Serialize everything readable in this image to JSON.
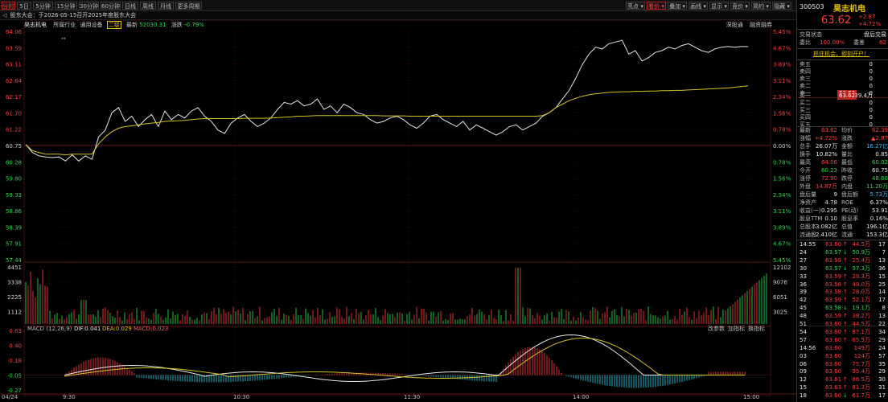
{
  "toolbar": {
    "tabs_left": [
      {
        "label": "分时",
        "active": true
      },
      {
        "label": "5日",
        "active": false
      },
      {
        "label": "5分钟",
        "active": false
      },
      {
        "label": "15分钟",
        "active": false
      },
      {
        "label": "30分钟",
        "active": false
      },
      {
        "label": "60分钟",
        "active": false
      },
      {
        "label": "日线",
        "active": false
      },
      {
        "label": "周线",
        "active": false
      },
      {
        "label": "月线",
        "active": false
      },
      {
        "label": "更多周期",
        "active": false
      }
    ],
    "tabs_right": [
      {
        "label": "亮点",
        "active": false
      },
      {
        "label": "看价",
        "active": true
      },
      {
        "label": "叠加",
        "active": false
      },
      {
        "label": "画线",
        "active": false
      },
      {
        "label": "显示",
        "active": false
      },
      {
        "label": "竞价",
        "active": false
      },
      {
        "label": "简约",
        "active": false
      },
      {
        "label": "隐藏",
        "active": false
      }
    ]
  },
  "notice": "股东大会：于2026-05-15召开2025年度股东大会",
  "infobar": {
    "name": "昊志机电",
    "industry_label": "所属行业",
    "industry": "通用设备",
    "level": "二级",
    "index_label": "最新",
    "index_value": "52030.31",
    "change_label": "涨跌",
    "change_value": "-0.79%",
    "right1": "深股通",
    "right2": "融资融券"
  },
  "price_axis": {
    "left": [
      "64.06",
      "63.59",
      "63.11",
      "62.64",
      "62.17",
      "61.70",
      "61.22",
      "60.75",
      "60.28",
      "59.80",
      "59.33",
      "58.86",
      "58.39",
      "57.91",
      "57.44"
    ],
    "right": [
      "5.45%",
      "4.67%",
      "3.89%",
      "3.11%",
      "2.34%",
      "1.56%",
      "0.78%",
      "0.00%",
      "0.78%",
      "1.56%",
      "2.34%",
      "3.11%",
      "3.89%",
      "4.67%",
      "5.45%"
    ]
  },
  "volume_axis": {
    "left": [
      "4451",
      "3338",
      "2225",
      "1112"
    ],
    "right": [
      "12102",
      "9076",
      "6051",
      "3025"
    ]
  },
  "macd": {
    "title": "MACD (12,26,9)",
    "dif": "DIF:0.041",
    "dea": "DEA:0.029",
    "macd": "MACD:0.023",
    "right_labels": [
      "改参数",
      "加指标",
      "换指标"
    ],
    "axis": [
      "0.63",
      "0.40",
      "0.18",
      "-0.05",
      "-0.27"
    ]
  },
  "time_axis": [
    "04/24",
    "9:30",
    "10:30",
    "11:30",
    "14:00",
    "15:00"
  ],
  "chart_data": {
    "type": "line",
    "series": [
      {
        "name": "price",
        "values": [
          60.78,
          60.55,
          60.45,
          60.42,
          60.4,
          60.42,
          60.3,
          60.48,
          60.3,
          60.45,
          60.35,
          61.0,
          61.2,
          61.7,
          61.85,
          61.45,
          61.6,
          61.3,
          61.5,
          61.65,
          61.3,
          61.75,
          61.5,
          61.65,
          61.55,
          61.75,
          61.85,
          61.6,
          61.45,
          61.2,
          61.1,
          61.4,
          61.55,
          61.65,
          61.45,
          61.3,
          61.4,
          61.55,
          61.8,
          62.0,
          61.95,
          62.05,
          61.9,
          61.95,
          62.1,
          61.8,
          61.9,
          61.7,
          61.95,
          61.85,
          61.7,
          61.65,
          61.5,
          61.4,
          61.45,
          61.55,
          61.6,
          61.5,
          61.35,
          61.25,
          61.4,
          61.6,
          61.65,
          61.5,
          61.4,
          61.3,
          61.45,
          61.2,
          61.35,
          61.25,
          61.15,
          61.05,
          61.15,
          61.3,
          61.35,
          61.2,
          61.3,
          61.4,
          61.6,
          61.7,
          61.85,
          62.1,
          62.35,
          62.7,
          63.1,
          63.4,
          63.6,
          63.55,
          63.7,
          63.75,
          63.8,
          63.4,
          63.5,
          63.2,
          63.3,
          63.45,
          63.5,
          63.6,
          63.55,
          63.65,
          63.7,
          63.6,
          63.5,
          63.45,
          63.55,
          63.6,
          63.62,
          63.6,
          63.62,
          63.62
        ]
      },
      {
        "name": "avg",
        "values": [
          60.78,
          60.6,
          60.55,
          60.5,
          60.5,
          60.5,
          60.48,
          60.5,
          60.5,
          60.5,
          60.5,
          60.8,
          61.0,
          61.15,
          61.25,
          61.3,
          61.32,
          61.35,
          61.38,
          61.4,
          61.42,
          61.45,
          61.46,
          61.47,
          61.48,
          61.5,
          61.52,
          61.53,
          61.53,
          61.53,
          61.53,
          61.53,
          61.53,
          61.54,
          61.54,
          61.54,
          61.54,
          61.55,
          61.56,
          61.57,
          61.58,
          61.6,
          61.6,
          61.61,
          61.62,
          61.62,
          61.62,
          61.62,
          61.62,
          61.62,
          61.62,
          61.62,
          61.62,
          61.62,
          61.61,
          61.61,
          61.61,
          61.61,
          61.6,
          61.6,
          61.6,
          61.6,
          61.6,
          61.6,
          61.6,
          61.6,
          61.6,
          61.6,
          61.6,
          61.6,
          61.6,
          61.6,
          61.6,
          61.6,
          61.6,
          61.6,
          61.6,
          61.6,
          61.62,
          61.7,
          61.85,
          61.95,
          62.05,
          62.12,
          62.18,
          62.22,
          62.25,
          62.27,
          62.29,
          62.3,
          62.31,
          62.31,
          62.32,
          62.32,
          62.33,
          62.33,
          62.34,
          62.34,
          62.35,
          62.35,
          62.36,
          62.37,
          62.38,
          62.39,
          62.4,
          62.41,
          62.42,
          62.44,
          62.46,
          62.48
        ]
      }
    ],
    "ylim": [
      57.44,
      64.06
    ]
  },
  "quote": {
    "code": "300503",
    "name": "昊志机电",
    "price": "63.62",
    "change": "+2.87",
    "pct": "+4.72%",
    "status_label": "交易状态",
    "status_value": "盘后交易",
    "ratio_label": "委比",
    "ratio_value": "100.00%",
    "diff_label": "委差",
    "diff_value": "62",
    "ad_text": "抓住机会，即刻开户！",
    "sells": [
      {
        "label": "卖五",
        "price": "",
        "vol": "0"
      },
      {
        "label": "卖四",
        "price": "",
        "vol": "0"
      },
      {
        "label": "卖三",
        "price": "",
        "vol": "0"
      },
      {
        "label": "卖二",
        "price": "",
        "vol": "0"
      },
      {
        "label": "卖一",
        "price": "63.62",
        "vol": "0"
      }
    ],
    "buys": [
      {
        "label": "买一",
        "price": "63.62",
        "vol": "39.4万"
      },
      {
        "label": "买二",
        "price": "",
        "vol": "0"
      },
      {
        "label": "买三",
        "price": "",
        "vol": "0"
      },
      {
        "label": "买四",
        "price": "",
        "vol": "0"
      },
      {
        "label": "买五",
        "price": "",
        "vol": "0"
      }
    ],
    "stats": [
      {
        "l1": "最新",
        "v1": "63.62",
        "c1": "red",
        "l2": "均价",
        "v2": "62.39",
        "c2": "red"
      },
      {
        "l1": "涨幅",
        "v1": "+4.72%",
        "c1": "red",
        "l2": "涨跌",
        "v2": "▲2.87",
        "c2": "red"
      },
      {
        "l1": "总手",
        "v1": "26.07万",
        "c1": "wht",
        "l2": "金额",
        "v2": "16.27亿",
        "c2": "cyan"
      },
      {
        "l1": "换手",
        "v1": "10.82%",
        "c1": "wht",
        "l2": "量比",
        "v2": "0.85",
        "c2": "wht"
      },
      {
        "l1": "最高",
        "v1": "64.06",
        "c1": "red",
        "l2": "最低",
        "v2": "60.02",
        "c2": "grn"
      },
      {
        "l1": "今开",
        "v1": "60.23",
        "c1": "grn",
        "l2": "昨收",
        "v2": "60.75",
        "c2": "wht"
      },
      {
        "l1": "涨停",
        "v1": "72.90",
        "c1": "red",
        "l2": "跌停",
        "v2": "48.60",
        "c2": "grn"
      },
      {
        "l1": "外盘",
        "v1": "14.87万",
        "c1": "red",
        "l2": "内盘",
        "v2": "11.20万",
        "c2": "grn"
      },
      {
        "l1": "盘后量",
        "v1": "9",
        "c1": "wht",
        "l2": "盘后额",
        "v2": "5.73万",
        "c2": "cyan"
      },
      {
        "l1": "净资产",
        "v1": "4.78",
        "c1": "wht",
        "l2": "ROE",
        "v2": "6.37%",
        "c2": "wht"
      },
      {
        "l1": "收益(一)",
        "v1": "0.295",
        "c1": "wht",
        "l2": "PE(动)",
        "v2": "53.91",
        "c2": "wht"
      },
      {
        "l1": "股息TTM",
        "v1": "0.10",
        "c1": "wht",
        "l2": "股息率",
        "v2": "0.16%",
        "c2": "wht"
      },
      {
        "l1": "总股本",
        "v1": "3.082亿",
        "c1": "wht",
        "l2": "总值",
        "v2": "196.1亿",
        "c2": "wht"
      },
      {
        "l1": "流通股",
        "v1": "2.410亿",
        "c1": "wht",
        "l2": "流通",
        "v2": "153.3亿",
        "c2": "wht"
      }
    ],
    "ticks": [
      {
        "t": "14:55",
        "p": "63.60",
        "d": "↑",
        "v": "44.5万",
        "n": "17",
        "c": "red"
      },
      {
        "t": "24",
        "p": "63.57",
        "d": "↓",
        "v": "50.9万",
        "n": "7",
        "c": "grn"
      },
      {
        "t": "27",
        "p": "63.59",
        "d": "↑",
        "v": "25.4万",
        "n": "13",
        "c": "red"
      },
      {
        "t": "30",
        "p": "63.57",
        "d": "↓",
        "v": "97.3万",
        "n": "36",
        "c": "grn"
      },
      {
        "t": "33",
        "p": "63.59",
        "d": "↑",
        "v": "29.3万",
        "n": "15",
        "c": "red"
      },
      {
        "t": "36",
        "p": "63.58",
        "d": "↑",
        "v": "49.0万",
        "n": "25",
        "c": "red"
      },
      {
        "t": "39",
        "p": "63.58",
        "d": "↑",
        "v": "28.0万",
        "n": "14",
        "c": "red"
      },
      {
        "t": "42",
        "p": "63.59",
        "d": "↑",
        "v": "52.1万",
        "n": "17",
        "c": "red"
      },
      {
        "t": "45",
        "p": "63.58",
        "d": "↓",
        "v": "19.1万",
        "n": "8",
        "c": "grn"
      },
      {
        "t": "48",
        "p": "63.59",
        "d": "↑",
        "v": "38.2万",
        "n": "13",
        "c": "red"
      },
      {
        "t": "51",
        "p": "63.60",
        "d": "↑",
        "v": "44.5万",
        "n": "22",
        "c": "red"
      },
      {
        "t": "54",
        "p": "63.60",
        "d": "↑",
        "v": "87.1万",
        "n": "34",
        "c": "red"
      },
      {
        "t": "57",
        "p": "63.60",
        "d": "↑",
        "v": "65.5万",
        "n": "29",
        "c": "red"
      },
      {
        "t": "14:56",
        "p": "63.60",
        "d": "",
        "v": "149万",
        "n": "24",
        "c": "red"
      },
      {
        "t": "03",
        "p": "63.60",
        "d": "",
        "v": "124万",
        "n": "57",
        "c": "red"
      },
      {
        "t": "06",
        "p": "63.60",
        "d": "",
        "v": "75.7万",
        "n": "35",
        "c": "red"
      },
      {
        "t": "09",
        "p": "63.60",
        "d": "",
        "v": "95.4万",
        "n": "29",
        "c": "red"
      },
      {
        "t": "12",
        "p": "63.61",
        "d": "↑",
        "v": "86.5万",
        "n": "30",
        "c": "red"
      },
      {
        "t": "15",
        "p": "63.63",
        "d": "↑",
        "v": "81.3万",
        "n": "31",
        "c": "red"
      },
      {
        "t": "18",
        "p": "63.60",
        "d": "↓",
        "v": "61.7万",
        "n": "17",
        "c": "red"
      }
    ]
  }
}
